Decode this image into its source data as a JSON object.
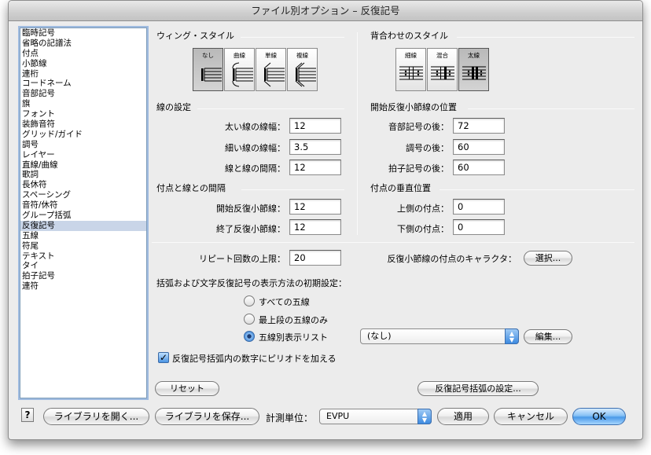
{
  "window": {
    "title": "ファイル別オプション – 反復記号"
  },
  "sidebar": {
    "items": [
      "臨時記号",
      "省略の記譜法",
      "付点",
      "小節線",
      "連桁",
      "コードネーム",
      "音部記号",
      "旗",
      "フォント",
      "装飾音符",
      "グリッド/ガイド",
      "調号",
      "レイヤー",
      "直線/曲線",
      "歌詞",
      "長休符",
      "スペーシング",
      "音符/休符",
      "グループ括弧",
      "反復記号",
      "五線",
      "符尾",
      "テキスト",
      "タイ",
      "拍子記号",
      "連符"
    ],
    "selected_index": 19
  },
  "wing_style": {
    "title": "ウィング・スタイル",
    "buttons": [
      "なし",
      "曲線",
      "単線",
      "複線"
    ],
    "selected_index": 0
  },
  "back_to_back": {
    "title": "背合わせのスタイル",
    "buttons": [
      "細線",
      "混合",
      "太線"
    ],
    "selected_index": 2
  },
  "line_settings": {
    "title": "線の設定",
    "thick_label": "太い線の線幅：",
    "thick_value": "12",
    "thin_label": "細い線の線幅：",
    "thin_value": "3.5",
    "space_label": "線と線の間隔：",
    "space_value": "12"
  },
  "start_barline_pos": {
    "title": "開始反復小節線の位置",
    "clef_label": "音部記号の後：",
    "clef_value": "72",
    "key_label": "調号の後：",
    "key_value": "60",
    "time_label": "拍子記号の後：",
    "time_value": "60"
  },
  "dot_spacing": {
    "title": "付点と線との間隔",
    "start_label": "開始反復小節線：",
    "start_value": "12",
    "end_label": "終了反復小節線：",
    "end_value": "12"
  },
  "dot_vertical": {
    "title": "付点の垂直位置",
    "upper_label": "上側の付点：",
    "upper_value": "0",
    "lower_label": "下側の付点：",
    "lower_value": "0"
  },
  "repeat_max": {
    "label": "リピート回数の上限：",
    "value": "20"
  },
  "dot_char": {
    "label": "反復小節線の付点のキャラクタ：",
    "button": "選択..."
  },
  "bracket_defaults": {
    "title": "括弧および文字反復記号の表示方法の初期設定：",
    "options": [
      "すべての五線",
      "最上段の五線のみ",
      "五線別表示リスト"
    ],
    "selected_index": 2,
    "popup_value": "(なし)",
    "edit_button": "編集..."
  },
  "period_checkbox": {
    "label": "反復記号括弧内の数字にピリオドを加える",
    "checked": true
  },
  "reset_button": "リセット",
  "bracket_settings_button": "反復記号括弧の設定...",
  "footer": {
    "help": "?",
    "open_library": "ライブラリを開く...",
    "save_library": "ライブラリを保存...",
    "units_label": "計測単位：",
    "units_value": "EVPU",
    "apply": "適用",
    "cancel": "キャンセル",
    "ok": "OK"
  }
}
